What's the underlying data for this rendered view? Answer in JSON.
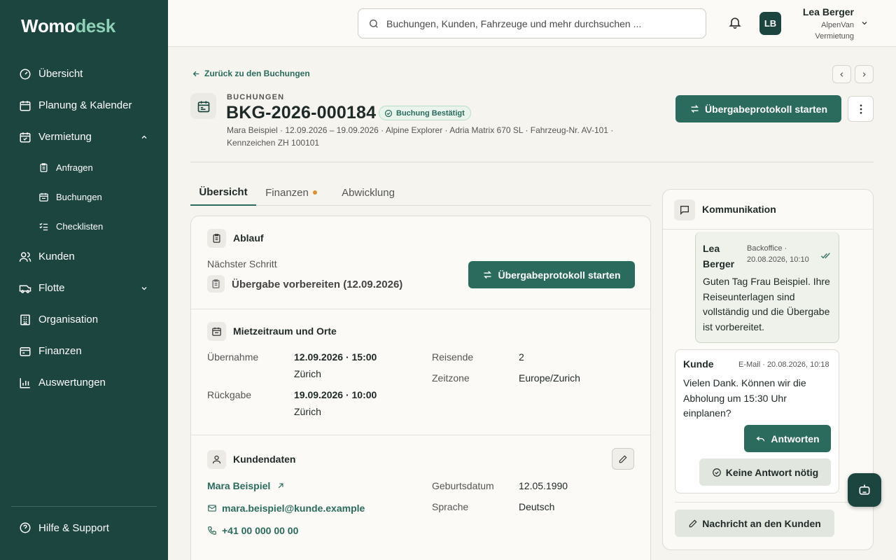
{
  "app": {
    "logo_w": "W",
    "logo_omo": "omo",
    "logo_desk": "desk"
  },
  "sidebar": {
    "items": [
      {
        "label": "Übersicht",
        "icon": "gauge-icon"
      },
      {
        "label": "Planung & Kalender",
        "icon": "calendar-icon"
      },
      {
        "label": "Vermietung",
        "icon": "calendar-check-icon",
        "expanded": true
      },
      {
        "label": "Kunden",
        "icon": "users-icon"
      },
      {
        "label": "Flotte",
        "icon": "van-icon"
      },
      {
        "label": "Organisation",
        "icon": "building-icon"
      },
      {
        "label": "Finanzen",
        "icon": "wallet-icon"
      },
      {
        "label": "Auswertungen",
        "icon": "bar-chart-icon"
      }
    ],
    "sub_items": [
      {
        "label": "Anfragen",
        "icon": "clipboard-icon"
      },
      {
        "label": "Buchungen",
        "icon": "calendar-icon"
      },
      {
        "label": "Checklisten",
        "icon": "checklist-icon"
      }
    ],
    "help_label": "Hilfe & Support"
  },
  "topbar": {
    "search_placeholder": "Buchungen, Kunden, Fahrzeuge und mehr durchsuchen ...",
    "avatar_initials": "LB",
    "user_name": "Lea Berger",
    "user_org_line1": "AlpenVan",
    "user_org_line2": "Vermietung"
  },
  "header": {
    "back_label": "Zurück zu den Buchungen",
    "overline": "BUCHUNGEN",
    "booking_id": "BKG-2026-000184",
    "status": "Buchung Bestätigt",
    "meta_line1": "Mara Beispiel · 12.09.2026 – 19.09.2026 · Alpine Explorer · Adria Matrix 670 SL · Fahrzeug-Nr. AV-101 ·",
    "meta_line2": "Kennzeichen ZH 100101",
    "primary_action": "Übergabeprotokoll starten"
  },
  "tabs": [
    {
      "label": "Übersicht",
      "active": true
    },
    {
      "label": "Finanzen",
      "has_indicator": true
    },
    {
      "label": "Abwicklung"
    }
  ],
  "ablauf": {
    "title": "Ablauf",
    "next_step_label": "Nächster Schritt",
    "next_step_value": "Übergabe vorbereiten (12.09.2026)",
    "action": "Übergabeprotokoll starten"
  },
  "mietzeitraum": {
    "title": "Mietzeitraum und Orte",
    "uebernahme_label": "Übernahme",
    "uebernahme_date": "12.09.2026 · 15:00",
    "uebernahme_place": "Zürich",
    "rueckgabe_label": "Rückgabe",
    "rueckgabe_date": "19.09.2026 · 10:00",
    "rueckgabe_place": "Zürich",
    "reisende_label": "Reisende",
    "reisende_value": "2",
    "zeitzone_label": "Zeitzone",
    "zeitzone_value": "Europe/Zurich"
  },
  "kunde": {
    "title": "Kundendaten",
    "name": "Mara Beispiel",
    "email": "mara.beispiel@kunde.example",
    "phone": "+41 00 000 00 00",
    "geburtsdatum_label": "Geburtsdatum",
    "geburtsdatum_value": "12.05.1990",
    "sprache_label": "Sprache",
    "sprache_value": "Deutsch"
  },
  "kommunikation": {
    "title": "Kommunikation",
    "messages": [
      {
        "author_line1": "Lea",
        "author_line2": "Berger",
        "meta_line1": "Backoffice ·",
        "meta_line2": "20.08.2026, 10:10",
        "body": "Guten Tag Frau Beispiel. Ihre Reiseunterlagen sind vollständig und die Übergabe ist vorbereitet."
      },
      {
        "author": "Kunde",
        "meta": "E-Mail · 20.08.2026, 10:18",
        "body": "Vielen Dank. Können wir die Abholung um 15:30 Uhr einplanen?"
      }
    ],
    "reply_label": "Antworten",
    "no_reply_label": "Keine Antwort nötig",
    "new_message_label": "Nachricht an den Kunden"
  },
  "colors": {
    "sidebar": "#1c4540",
    "accent": "#2b6b5e",
    "indicator": "#e0902d",
    "background": "#f5f4ef"
  }
}
